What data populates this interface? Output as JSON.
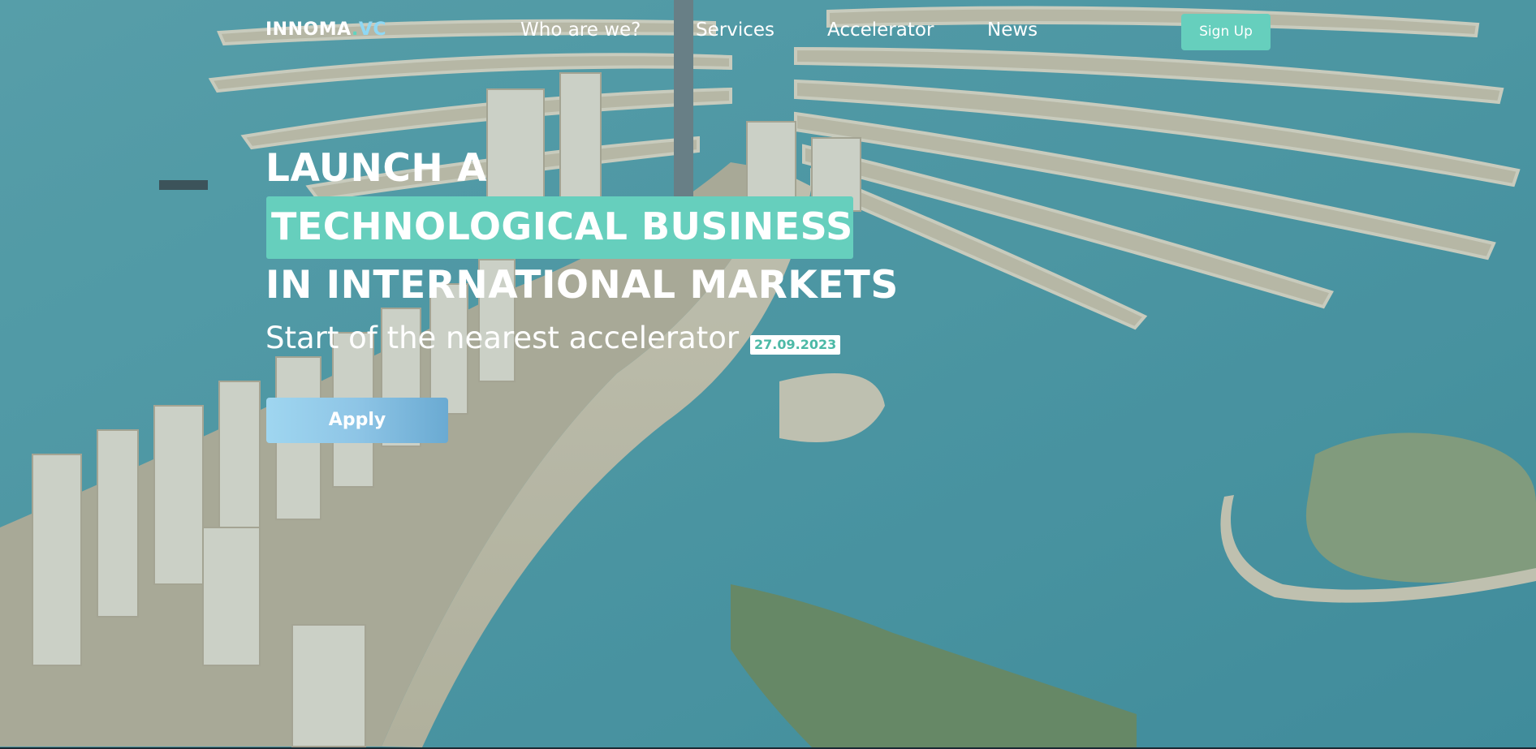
{
  "header": {
    "logo": {
      "main": "INNOMA",
      "dot": ".",
      "suffix": "VC"
    },
    "nav": [
      "Who are we?",
      "Services",
      "Accelerator",
      "News"
    ],
    "signup_label": "Sign Up"
  },
  "hero": {
    "line1": "LAUNCH A",
    "line2": "TECHNOLOGICAL BUSINESS",
    "line3": "IN INTERNATIONAL MARKETS",
    "subtitle": "Start of the nearest accelerator",
    "date": "27.09.2023",
    "apply_label": "Apply"
  },
  "colors": {
    "accent": "#66cfbd",
    "logo_suffix": "#8fd8f4",
    "apply_gradient_start": "#9fd6f0",
    "apply_gradient_end": "#6aaad2"
  },
  "background": {
    "icon": "aerial-palm-island-photo"
  }
}
